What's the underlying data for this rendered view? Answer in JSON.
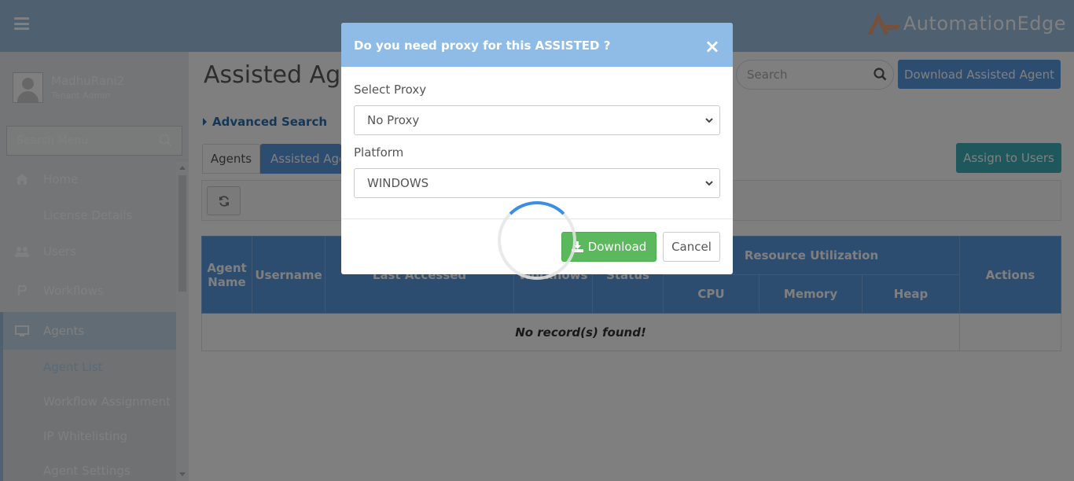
{
  "header": {
    "logo_text": "AutomationEdge"
  },
  "sidebar": {
    "user_name": "MadhuRani2",
    "user_role": "Tenant Admin",
    "search_placeholder": "Search Menu",
    "items": [
      {
        "label": "Home",
        "icon": "home-icon"
      },
      {
        "label": "License Details",
        "icon": ""
      },
      {
        "label": "Users",
        "icon": "users-icon"
      },
      {
        "label": "Workflows",
        "icon": "workflow-icon"
      },
      {
        "label": "Agents",
        "icon": "monitor-icon"
      },
      {
        "label": "Agent List",
        "icon": ""
      },
      {
        "label": "Workflow Assignment",
        "icon": ""
      },
      {
        "label": "IP Whitelisting",
        "icon": ""
      },
      {
        "label": "Agent Settings",
        "icon": ""
      }
    ]
  },
  "main": {
    "page_title": "Assisted Agents",
    "advanced_search": "Advanced Search",
    "search_placeholder": "Search",
    "download_agent_button": "Download Assisted Agent",
    "tabs": [
      {
        "label": "Agents"
      },
      {
        "label": "Assisted Agents"
      }
    ],
    "assign_button": "Assign to Users",
    "table": {
      "headers": {
        "agent_name": "Agent Name",
        "username": "Username",
        "last_accessed": "Last Accessed",
        "workflows": "Workflows",
        "status": "Status",
        "resource_utilization": "Resource Utilization",
        "cpu": "CPU",
        "memory": "Memory",
        "heap": "Heap",
        "actions": "Actions"
      },
      "empty_message": "No record(s) found!"
    }
  },
  "modal": {
    "title": "Do you need proxy for this ASSISTED ?",
    "close_symbol": "×",
    "proxy_label": "Select Proxy",
    "proxy_value": "No Proxy",
    "platform_label": "Platform",
    "platform_value": "WINDOWS",
    "download_button": "Download",
    "cancel_button": "Cancel"
  },
  "colors": {
    "primary": "#5a9be0",
    "header": "#9fc0e2",
    "success": "#5cb85c",
    "info": "#3fb0b8"
  }
}
